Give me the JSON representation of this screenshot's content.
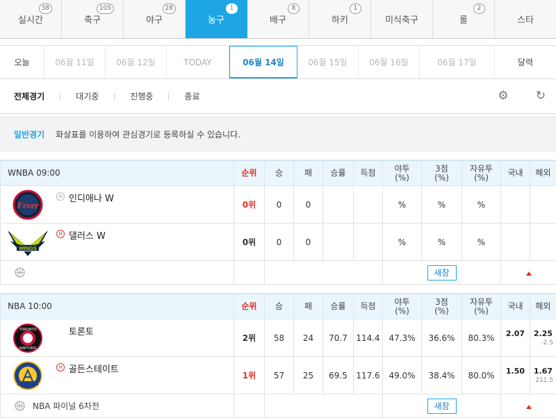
{
  "sport_tabs": [
    {
      "label": "실시간",
      "count": "38"
    },
    {
      "label": "축구",
      "count": "105"
    },
    {
      "label": "야구",
      "count": "28"
    },
    {
      "label": "농구",
      "count": "1"
    },
    {
      "label": "배구",
      "count": "8"
    },
    {
      "label": "하키",
      "count": "1"
    },
    {
      "label": "미식축구",
      "count": ""
    },
    {
      "label": "롤",
      "count": "2"
    },
    {
      "label": "스타",
      "count": ""
    }
  ],
  "active_sport": "농구",
  "date_tabs": {
    "today": "오늘",
    "d1": "06월 11일",
    "d2": "06월 12일",
    "today_mark": "TODAY",
    "active": "06월 14일",
    "d3": "06월 15일",
    "d4": "06월 16일",
    "d5": "06월 17일",
    "calendar": "달력"
  },
  "status_filter": [
    "전체경기",
    "대기중",
    "진행중",
    "종료"
  ],
  "notice": {
    "title": "일반경기",
    "text": "화살표를 이용하여 관심경기로 등록하실 수 있습니다."
  },
  "table_headers": {
    "rank": "순위",
    "win": "승",
    "loss": "패",
    "pct": "승률",
    "pts": "득점",
    "fg": "야투\n(%)",
    "three": "3점\n(%)",
    "ft": "자유투\n(%)",
    "dom": "국내",
    "ovs": "해외"
  },
  "games": [
    {
      "league_time": "WNBA  09:00",
      "teams": [
        {
          "ha": "A",
          "name": "인디애나 W",
          "rank": "0위",
          "win": "0",
          "loss": "0",
          "pct": "",
          "pts": "",
          "fg": "%",
          "three": "%",
          "ft": "%",
          "dom": "",
          "ovs": "",
          "ovs_sub": ""
        },
        {
          "ha": "H",
          "name": "댈러스 W",
          "rank": "0위",
          "win": "0",
          "loss": "0",
          "pct": "",
          "pts": "",
          "fg": "%",
          "three": "%",
          "ft": "%",
          "dom": "",
          "ovs": "",
          "ovs_sub": ""
        }
      ],
      "foot_label": "",
      "new_window": "새창"
    },
    {
      "league_time": "NBA  10:00",
      "teams": [
        {
          "ha": "",
          "name": "토론토",
          "rank": "2위",
          "win": "58",
          "loss": "24",
          "pct": "70.7",
          "pts": "114.4",
          "fg": "47.3%",
          "three": "36.6%",
          "ft": "80.3%",
          "dom": "2.07",
          "ovs": "2.25",
          "ovs_sub": "-2.5"
        },
        {
          "ha": "H",
          "name": "골든스테이트",
          "rank": "1위",
          "win": "57",
          "loss": "25",
          "pct": "69.5",
          "pts": "117.6",
          "fg": "49.0%",
          "three": "38.4%",
          "ft": "80.0%",
          "dom": "1.50",
          "ovs": "1.67",
          "ovs_sub": "211.5"
        }
      ],
      "foot_label": "NBA 파이널 6차전",
      "new_window": "새창"
    }
  ],
  "colors": {
    "accent": "#1ea6e4",
    "rank_red": "#e0302a",
    "header_bg": "#eaf5fc"
  }
}
